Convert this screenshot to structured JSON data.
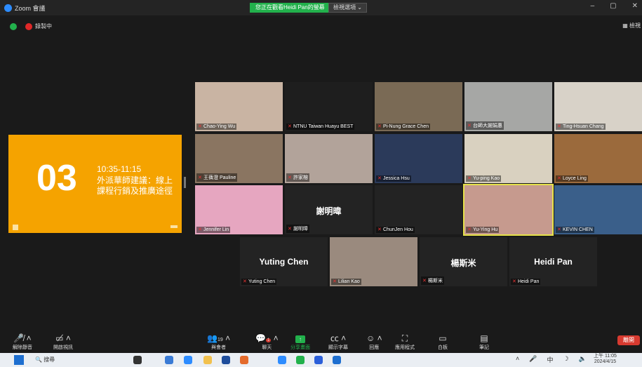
{
  "window": {
    "title": "Zoom 會議",
    "share_banner": "您正在觀看Heidi Pan的螢幕",
    "view_option": "檢視選項 ⌄",
    "controls": [
      "–",
      "▢",
      "✕"
    ]
  },
  "status": {
    "recording_label": "錄製中",
    "view_label": "▦ 檢視"
  },
  "shared_slide": {
    "number": "03",
    "time": "10:35-11:15",
    "title": "外派華師建議：線上課程行銷及推廣途徑"
  },
  "participants": [
    {
      "name": "Chao-Ying Wu",
      "bg": "#c9b4a3"
    },
    {
      "name": "NTNU Taiwan Huayu BEST",
      "bg": "#1e1e1e"
    },
    {
      "name": "Pi-Nung Grace Chen",
      "bg": "#7a6a55"
    },
    {
      "name": "台師大謝娟惠",
      "bg": "#a6a7a5"
    },
    {
      "name": "Ting-Hsuan Chang",
      "bg": "#d8d2c8"
    },
    {
      "name": "王蒨澄 Pauline",
      "bg": "#8a7561"
    },
    {
      "name": "許家榕",
      "bg": "#b2a39a"
    },
    {
      "name": "Jessica Hsu",
      "bg": "#2b3a5a"
    },
    {
      "name": "Yu-ping Kao",
      "bg": "#d9d1c0"
    },
    {
      "name": "Loyce Ling",
      "bg": "#9b6a3c"
    },
    {
      "name": "Jennifer Lin",
      "bg": "#e6a6c0"
    },
    {
      "name": "謝明暐",
      "bg": "#232323",
      "display": "謝明暐"
    },
    {
      "name": "ChunJen Hou",
      "bg": "#232323"
    },
    {
      "name": "Yu-Ying Hu",
      "bg": "#c69a8e"
    },
    {
      "name": "KEVIN CHEN",
      "bg": "#3a5f8a"
    },
    {
      "name": "Yuting Chen",
      "bg": "#232323",
      "display": "Yuting Chen"
    },
    {
      "name": "Lilian Kao",
      "bg": "#9a8a7e"
    },
    {
      "name": "楊斯米",
      "bg": "#232323",
      "display": "楊斯米"
    },
    {
      "name": "Heidi Pan",
      "bg": "#232323",
      "display": "Heidi Pan"
    }
  ],
  "toolbar": {
    "unmute": "解除靜音",
    "start_video": "開啟視訊",
    "participants": "與會者",
    "participants_count": "19",
    "chat": "聊天",
    "chat_badge": "1",
    "share": "分享畫面",
    "captions": "顯示字幕",
    "reactions": "回應",
    "apps": "應用程式",
    "whiteboard": "白板",
    "notes": "筆記",
    "leave": "離開"
  },
  "taskbar": {
    "search_placeholder": "搜尋",
    "time": "上午 11:05",
    "date": "2024/4/15",
    "ime": "中"
  },
  "colors": {
    "share_green": "#22b14c",
    "slide_orange": "#f5a300",
    "leave_red": "#d73a30",
    "speaker_yellow": "#e6e24a"
  }
}
